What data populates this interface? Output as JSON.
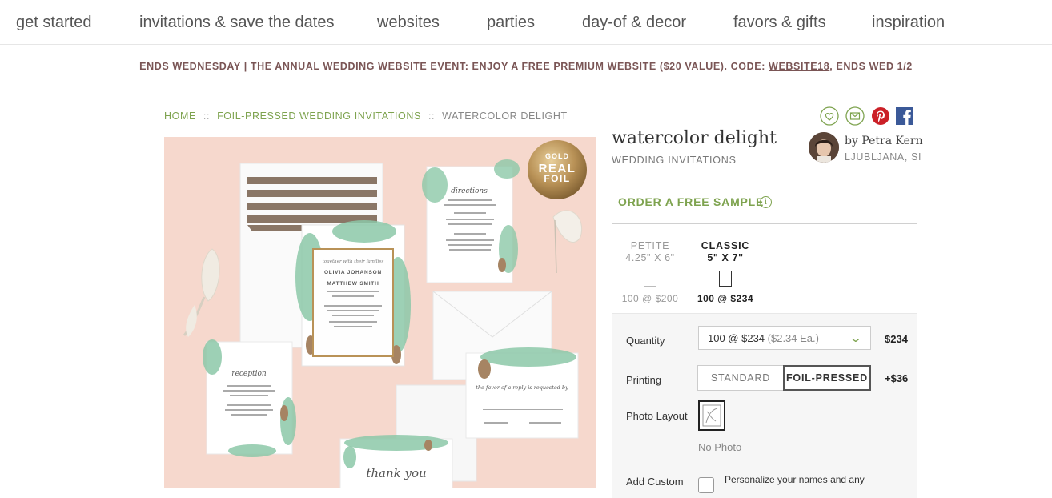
{
  "nav": {
    "items": [
      "get started",
      "invitations & save the dates",
      "websites",
      "parties",
      "day-of & decor",
      "favors & gifts",
      "inspiration"
    ]
  },
  "promo": {
    "text": "ENDS WEDNESDAY | THE ANNUAL WEDDING WEBSITE EVENT: ENJOY A FREE PREMIUM WEBSITE ($20 VALUE). CODE: ",
    "code": "WEBSITE18",
    "suffix": ", ENDS WED 1/2"
  },
  "breadcrumb": {
    "home": "HOME",
    "separator": "::",
    "category": "FOIL-PRESSED WEDDING INVITATIONS",
    "current": "WATERCOLOR DELIGHT"
  },
  "photo": {
    "badge_line1": "GOLD",
    "badge_line2": "REAL",
    "badge_line3": "FOIL",
    "names_line1": "OLIVIA JOHANSON",
    "names_line2": "MATTHEW SMITH",
    "card_directions": "directions",
    "card_reception": "reception",
    "card_thanks": "thank you",
    "card_rsvp": "the favor of a reply is requested by"
  },
  "social": {
    "icons": [
      "heart-icon",
      "mail-icon",
      "pinterest-icon",
      "facebook-icon"
    ],
    "colors": {
      "green": "#7ea34f",
      "pinterest": "#cb2027",
      "facebook": "#3b5998"
    }
  },
  "product": {
    "title": "watercolor delight",
    "subtitle": "WEDDING INVITATIONS",
    "by": "by Petra Kern",
    "location": "LJUBLJANA, SI"
  },
  "sample": {
    "label": "ORDER A FREE SAMPLE",
    "info_glyph": "i"
  },
  "sizes": [
    {
      "name": "PETITE",
      "dims": "4.25\" X 6\"",
      "price": "100 @ $200"
    },
    {
      "name": "CLASSIC",
      "dims": "5\" X 7\"",
      "price": "100 @ $234"
    }
  ],
  "options": {
    "quantity_label": "Quantity",
    "quantity_value": "100 @ $234",
    "quantity_each": "($2.34 Ea.)",
    "quantity_amount": "$234",
    "printing_label": "Printing",
    "printing_standard": "STANDARD",
    "printing_foil": "FOIL-PRESSED",
    "printing_amount": "+$36",
    "layout_label": "Photo Layout",
    "layout_value": "No Photo",
    "custom_label": "Add Custom",
    "custom_text": "Personalize your names and any"
  },
  "colors": {
    "accent_green": "#7ea34f",
    "promo_text": "#7a5555",
    "photo_bg": "#f6d8cd"
  }
}
